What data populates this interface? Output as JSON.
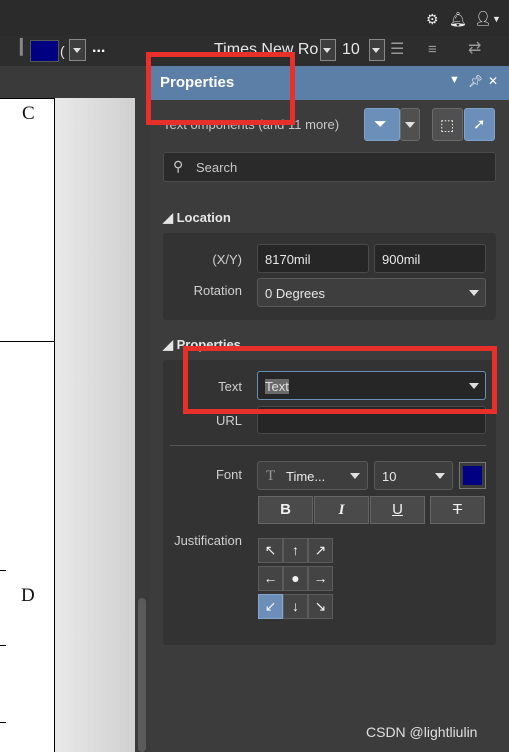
{
  "topbar": {
    "icons": [
      "gear-icon",
      "bell-icon",
      "user-icon"
    ]
  },
  "toolbar": {
    "color_label": "(",
    "more_label": "...",
    "font_name": "Times New Ro",
    "font_size": "10"
  },
  "document": {
    "row_c_label": "C",
    "row_d_label": "D"
  },
  "panel": {
    "title": "Properties",
    "filter_text": "Text  omponents (and 11 more)",
    "search_placeholder": "Search",
    "location": {
      "header": "Location",
      "xy_label": "(X/Y)",
      "x_value": "8170mil",
      "y_value": "900mil",
      "rotation_label": "Rotation",
      "rotation_value": "0 Degrees"
    },
    "properties": {
      "header": "Properties",
      "text_label": "Text",
      "text_value": "Text",
      "url_label": "URL",
      "url_value": "",
      "font_label": "Font",
      "font_value": "Time...",
      "font_size": "10",
      "font_color": "#000080",
      "bold": "B",
      "italic": "I",
      "underline": "U",
      "strike": "T",
      "justification_label": "Justification",
      "justification_selected": "bottom-left"
    }
  },
  "watermark": "CSDN @lightliulin"
}
